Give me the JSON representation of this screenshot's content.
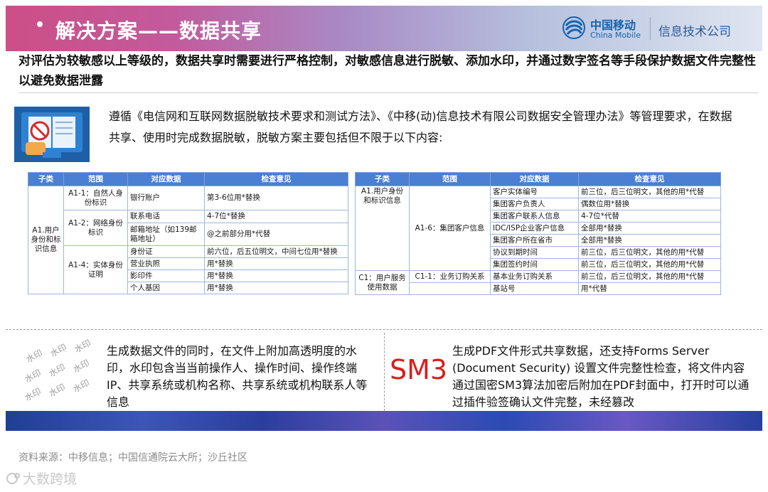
{
  "header": {
    "title": "解决方案——数据共享",
    "brand_cn": "中国移动",
    "brand_en": "China Mobile",
    "company": "信息技术公司"
  },
  "intro": "对评估为较敏感以上等级的，数据共享时需要进行严格控制，对敏感信息进行脱敏、添加水印，并通过数字签名等手段保护数据文件完整性以避免数据泄露",
  "paragraph": "遵循《电信网和互联网数据脱敏技术要求和测试方法》、《中移(动)信息技术有限公司数据安全管理办法》等管理要求，在数据共享、使用时完成数据脱敏，脱敏方案主要包括但不限于以下内容:",
  "table1": {
    "headers": [
      "子类",
      "范围",
      "对应数据",
      "检查意见"
    ],
    "group": "A1.用户身份和标识信息",
    "scope1": "A1-1：自然人身份标识",
    "scope2": "A1-2：网络身份标识",
    "scope3": "A1-4：实体身份证明",
    "rows": [
      {
        "data": "银行账户",
        "opinion": "第3-6位用*替换"
      },
      {
        "data": "联系电话",
        "opinion": "4-7位*替换"
      },
      {
        "data": "邮箱地址（如139邮箱地址）",
        "opinion": "@之前部分用*代替"
      },
      {
        "data": "身份证",
        "opinion": "前六位，后五位明文，中间七位用*替换"
      },
      {
        "data": "营业执照",
        "opinion": "用*替换"
      },
      {
        "data": "影印件",
        "opinion": "用*替换"
      },
      {
        "data": "个人基因",
        "opinion": "用*替换"
      }
    ]
  },
  "table2": {
    "headers": [
      "子类",
      "范围",
      "对应数据",
      "检查意见"
    ],
    "group1": "A1.用户身份和标识信息",
    "scope1": "A1-6：集团客户信息",
    "group2": "C1：用户服务使用数据",
    "scope2": "C1-1：业务订购关系",
    "rows": [
      {
        "data": "客户实体编号",
        "opinion": "前三位，后三位明文，其他的用*代替"
      },
      {
        "data": "集团客户负责人",
        "opinion": "偶数位用*替换"
      },
      {
        "data": "集团客户联系人信息",
        "opinion": "4-7位*代替"
      },
      {
        "data": "IDC/ISP企业客户信息",
        "opinion": "全部用*替换"
      },
      {
        "data": "集团客户所在省市",
        "opinion": "全部用*替换"
      },
      {
        "data": "协议到期时间",
        "opinion": "前三位，后三位明文，其他的用*代替"
      },
      {
        "data": "集团签约时间",
        "opinion": "前三位，后三位明文，其他的用*代替"
      },
      {
        "data": "基本业务订购关系",
        "opinion": "前三位，后三位明文，其他的用*代替"
      },
      {
        "data": "基站号",
        "opinion": "用*代替"
      }
    ]
  },
  "watermark_text": "水印",
  "left_text": "生成数据文件的同时，在文件上附加高透明度的水印，水印包含当当前操作人、操作时间、操作终端IP、共享系统或机构名称、共享系统或机构联系人等信息",
  "sm3_label": "SM3",
  "right_text": "生成PDF文件形式共享数据，还支持Forms Server (Document Security) 设置文件完整性检查，将文件内容通过国密SM3算法加密后附加在PDF封面中，打开时可以通过插件验签确认文件完整，未经篡改",
  "source": "资料来源：中移信息；中国信通院云大所；沙丘社区",
  "corner_mark": "大数跨境",
  "colors": {
    "accent_red": "#d81e1e",
    "table_header": "#4a7fd4",
    "brand_blue": "#1563b0"
  }
}
